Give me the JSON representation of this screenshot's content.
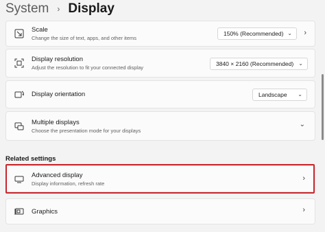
{
  "breadcrumb": {
    "parent": "System",
    "separator": "›",
    "current": "Display"
  },
  "scale": {
    "icon": "scale-icon",
    "title": "Scale",
    "subtitle": "Change the size of text, apps, and other items",
    "value": "150% (Recommended)"
  },
  "resolution": {
    "icon": "resolution-icon",
    "title": "Display resolution",
    "subtitle": "Adjust the resolution to fit your connected display",
    "value": "3840 × 2160 (Recommended)"
  },
  "orientation": {
    "icon": "orientation-icon",
    "title": "Display orientation",
    "value": "Landscape"
  },
  "multiple": {
    "icon": "multiple-displays-icon",
    "title": "Multiple displays",
    "subtitle": "Choose the presentation mode for your displays"
  },
  "related_label": "Related settings",
  "advanced": {
    "icon": "monitor-icon",
    "title": "Advanced display",
    "subtitle": "Display information, refresh rate"
  },
  "graphics": {
    "icon": "graphics-card-icon",
    "title": "Graphics"
  },
  "colors": {
    "highlight": "#c8262b",
    "card": "#fbfbfb",
    "background": "#f3f3f3"
  }
}
